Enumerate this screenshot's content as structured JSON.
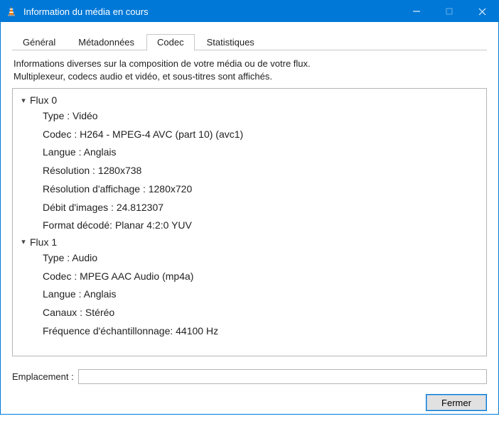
{
  "window": {
    "title": "Information du média en cours"
  },
  "tabs": {
    "general": "Général",
    "metadata": "Métadonnées",
    "codec": "Codec",
    "stats": "Statistiques"
  },
  "description": {
    "line1": "Informations diverses sur la composition de votre média ou de votre flux.",
    "line2": "Multiplexeur, codecs audio et vidéo, et sous-titres sont affichés."
  },
  "streams": [
    {
      "header": "Flux 0",
      "props": [
        "Type : Vidéo",
        "Codec : H264 - MPEG-4 AVC (part 10) (avc1)",
        "Langue : Anglais",
        "Résolution : 1280x738",
        "Résolution d'affichage : 1280x720",
        "Débit d'images : 24.812307",
        "Format décodé: Planar 4:2:0 YUV"
      ]
    },
    {
      "header": "Flux 1",
      "props": [
        "Type : Audio",
        "Codec : MPEG AAC Audio (mp4a)",
        "Langue : Anglais",
        "Canaux : Stéréo",
        "Fréquence d'échantillonnage: 44100 Hz"
      ]
    }
  ],
  "footer": {
    "location_label": "Emplacement :",
    "location_value": "",
    "close_label": "Fermer"
  }
}
